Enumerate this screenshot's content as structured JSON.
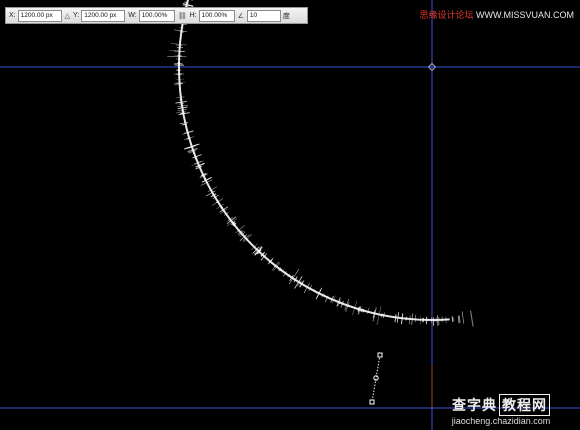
{
  "optionsBar": {
    "x_label": "X:",
    "x_value": "1200.00 px",
    "y_label": "Y:",
    "y_value": "1200.00 px",
    "w_label": "W:",
    "w_value": "100.00%",
    "h_label": "H:",
    "h_value": "100.00%",
    "angle_value": "10",
    "angle_unit": "度",
    "icons": [
      "reference-point-icon",
      "link-icon",
      "angle-icon"
    ]
  },
  "watermarks": {
    "top_cn": "思缘设计论坛",
    "top_url": "WWW.MISSVUAN.COM",
    "bottom_brand_a": "查字典",
    "bottom_brand_b": "教程网",
    "bottom_url": "jiaocheng.chazidian.com"
  },
  "colors": {
    "background": "#000000",
    "guide": "#3d4fd8",
    "sparkle": "#ffffff",
    "accent": "#e0352b"
  }
}
